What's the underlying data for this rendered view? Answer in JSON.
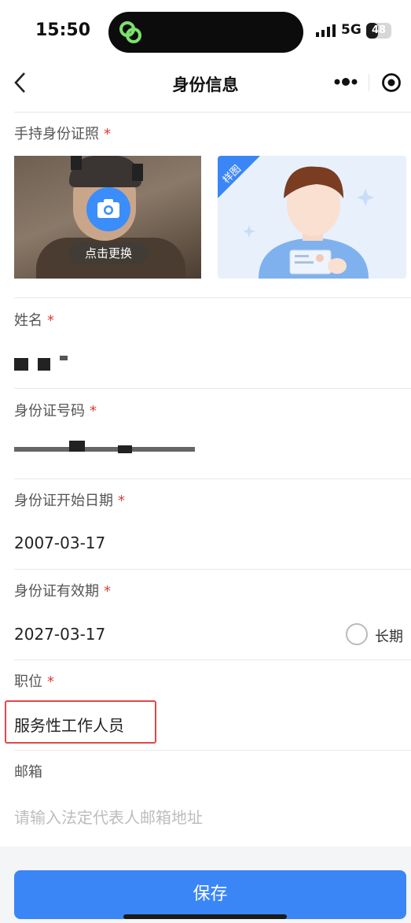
{
  "status_bar": {
    "time": "15:50",
    "network": "5G",
    "battery": "48",
    "battery_level": 0.48
  },
  "nav": {
    "title": "身份信息",
    "back_icon": "chevron-left-icon",
    "more_icon": "more-dots-icon",
    "target_icon": "target-icon"
  },
  "photo_section": {
    "label": "手持身份证照",
    "required": "*",
    "change_text": "点击更换",
    "sample_tag": "样图"
  },
  "fields": {
    "name": {
      "label": "姓名",
      "required": "*",
      "value": ""
    },
    "id_number": {
      "label": "身份证号码",
      "required": "*",
      "value": ""
    },
    "id_start": {
      "label": "身份证开始日期",
      "required": "*",
      "value": "2007-03-17"
    },
    "id_valid": {
      "label": "身份证有效期",
      "required": "*",
      "value": "2027-03-17",
      "long_term_label": "长期"
    },
    "position": {
      "label": "职位",
      "required": "*",
      "value": "服务性工作人员"
    },
    "email": {
      "label": "邮箱",
      "placeholder": "请输入法定代表人邮箱地址"
    }
  },
  "footer": {
    "save_label": "保存"
  },
  "colors": {
    "accent": "#3b86f7",
    "required": "#e53935",
    "highlight_box": "#e04848"
  }
}
